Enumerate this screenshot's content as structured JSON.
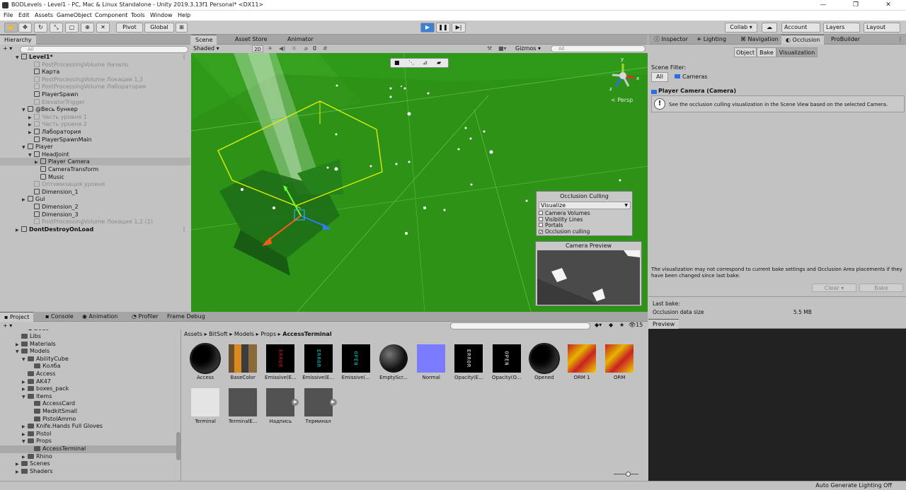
{
  "window": {
    "title": "BODLevels - Level1 - PC, Mac & Linux Standalone - Unity 2019.3.13f1 Personal* <DX11>",
    "minimize": "—",
    "maximize": "❐",
    "close": "✕"
  },
  "menu": [
    "File",
    "Edit",
    "Assets",
    "GameObject",
    "Component",
    "Tools",
    "Window",
    "Help"
  ],
  "toolbar": {
    "pivot": "Pivot",
    "global": "Global",
    "collab": "Collab ▾",
    "account": "Account",
    "layers": "Layers",
    "layout": "Layout",
    "play_icon": "play-icon",
    "pause_icon": "pause-icon",
    "step_icon": "step-icon"
  },
  "hierarchy": {
    "tab": "Hierarchy",
    "add": "+ ▾",
    "search_placeholder": "All",
    "rows": [
      {
        "label": "Level1*",
        "indent": 0,
        "arrow": "▼",
        "dim": false,
        "sel": false,
        "scene": true
      },
      {
        "label": "PostProcessingVolume Начало",
        "indent": 2,
        "arrow": "",
        "dim": true,
        "sel": false
      },
      {
        "label": "Карта",
        "indent": 2,
        "arrow": "",
        "dim": false,
        "sel": false
      },
      {
        "label": "PostProcessingVolume Локация 1,2",
        "indent": 2,
        "arrow": "",
        "dim": true,
        "sel": false
      },
      {
        "label": "PostProcessingVolume Лаборатория",
        "indent": 2,
        "arrow": "",
        "dim": true,
        "sel": false
      },
      {
        "label": "PlayerSpawn",
        "indent": 2,
        "arrow": "",
        "dim": false,
        "sel": false
      },
      {
        "label": "ElevatorTrigger",
        "indent": 2,
        "arrow": "",
        "dim": true,
        "sel": false
      },
      {
        "label": "@Весь бункер",
        "indent": 1,
        "arrow": "▼",
        "dim": false,
        "sel": false
      },
      {
        "label": "Часть уровня 1",
        "indent": 2,
        "arrow": "▶",
        "dim": true,
        "sel": false
      },
      {
        "label": "Часть уровня 2",
        "indent": 2,
        "arrow": "▶",
        "dim": true,
        "sel": false
      },
      {
        "label": "Лаборатория",
        "indent": 2,
        "arrow": "▶",
        "dim": false,
        "sel": false
      },
      {
        "label": "PlayerSpawnMain",
        "indent": 2,
        "arrow": "",
        "dim": false,
        "sel": false
      },
      {
        "label": "Player",
        "indent": 1,
        "arrow": "▼",
        "dim": false,
        "sel": false
      },
      {
        "label": "HeadJoint",
        "indent": 2,
        "arrow": "▼",
        "dim": false,
        "sel": false
      },
      {
        "label": "Player Camera",
        "indent": 3,
        "arrow": "▶",
        "dim": false,
        "sel": true
      },
      {
        "label": "CameraTransform",
        "indent": 3,
        "arrow": "",
        "dim": false,
        "sel": false
      },
      {
        "label": "Music",
        "indent": 3,
        "arrow": "",
        "dim": false,
        "sel": false
      },
      {
        "label": "Оптимизация уровня",
        "indent": 2,
        "arrow": "",
        "dim": true,
        "sel": false
      },
      {
        "label": "Dimension_1",
        "indent": 2,
        "arrow": "",
        "dim": false,
        "sel": false
      },
      {
        "label": "Gui",
        "indent": 1,
        "arrow": "▶",
        "dim": false,
        "sel": false
      },
      {
        "label": "Dimension_2",
        "indent": 2,
        "arrow": "",
        "dim": false,
        "sel": false
      },
      {
        "label": "Dimension_3",
        "indent": 2,
        "arrow": "",
        "dim": false,
        "sel": false
      },
      {
        "label": "PostProcessingVolume Локация 1,2 (1)",
        "indent": 2,
        "arrow": "",
        "dim": true,
        "sel": false
      },
      {
        "label": "DontDestroyOnLoad",
        "indent": 0,
        "arrow": "▶",
        "dim": false,
        "sel": false,
        "scene": true
      }
    ]
  },
  "scene_view": {
    "tabs": [
      "Scene",
      "Asset Store",
      "Animator"
    ],
    "shading": "Shaded ▾",
    "mode_2d": "2D",
    "gizmos": "Gizmos ▾",
    "search_placeholder": "All",
    "persp": "< Persp",
    "hidden_count": "0",
    "gizmo_axes": {
      "x": "x",
      "y": "y",
      "z": "z"
    },
    "occlusion_overlay": {
      "title": "Occlusion Culling",
      "dropdown": "Visualize",
      "options": [
        {
          "label": "Camera Volumes",
          "checked": false
        },
        {
          "label": "Visibility Lines",
          "checked": false
        },
        {
          "label": "Portals",
          "checked": false
        },
        {
          "label": "Occlusion culling",
          "checked": true
        }
      ]
    },
    "camera_preview_title": "Camera Preview"
  },
  "inspector": {
    "tabs": [
      "Inspector",
      "Lighting",
      "Navigation",
      "Occlusion",
      "ProBuilder"
    ],
    "subtabs": [
      "Object",
      "Bake",
      "Visualization"
    ],
    "scene_filter_label": "Scene Filter:",
    "filter_all": "All",
    "filter_cameras": "Cameras",
    "camera_header": "Player Camera (Camera)",
    "info_text": "See the occlusion culling visualization in the Scene View based on the selected Camera.",
    "warning_text": "The visualization may not correspond to current bake settings and Occlusion Area placements if they have been changed since last bake.",
    "clear": "Clear",
    "bake": "Bake",
    "last_bake_label": "Last bake:",
    "occlusion_size_label": "Occlusion data size",
    "occlusion_size_value": "5.5 MB",
    "preview_tab": "Preview"
  },
  "project": {
    "tabs": [
      "Project",
      "Console",
      "Animation",
      "Profiler",
      "Frame Debug"
    ],
    "add": "+ ▾",
    "hidden_count": "15",
    "breadcrumb": [
      "Assets",
      "BitSoft",
      "Models",
      "Props",
      "AccessTerminal"
    ],
    "tree": [
      {
        "label": "Libs",
        "indent": 2,
        "arrow": ""
      },
      {
        "label": "Materials",
        "indent": 2,
        "arrow": "▶"
      },
      {
        "label": "Models",
        "indent": 2,
        "arrow": "▼"
      },
      {
        "label": "AbilityCube",
        "indent": 3,
        "arrow": "▼"
      },
      {
        "label": "Колба",
        "indent": 4,
        "arrow": ""
      },
      {
        "label": "Access",
        "indent": 3,
        "arrow": ""
      },
      {
        "label": "AK47",
        "indent": 3,
        "arrow": "▶"
      },
      {
        "label": "boxes_pack",
        "indent": 3,
        "arrow": "▶"
      },
      {
        "label": "Items",
        "indent": 3,
        "arrow": "▼"
      },
      {
        "label": "AccessCard",
        "indent": 4,
        "arrow": ""
      },
      {
        "label": "MedkitSmall",
        "indent": 4,
        "arrow": ""
      },
      {
        "label": "PistolAmmo",
        "indent": 4,
        "arrow": ""
      },
      {
        "label": "Knife.Hands Full Gloves",
        "indent": 3,
        "arrow": "▶"
      },
      {
        "label": "Pistol",
        "indent": 3,
        "arrow": "▶"
      },
      {
        "label": "Props",
        "indent": 3,
        "arrow": "▼"
      },
      {
        "label": "AccessTerminal",
        "indent": 4,
        "arrow": "",
        "sel": true
      },
      {
        "label": "Rhino",
        "indent": 3,
        "arrow": "▶"
      },
      {
        "label": "Scenes",
        "indent": 2,
        "arrow": "▶"
      },
      {
        "label": "Shaders",
        "indent": 2,
        "arrow": "▶"
      }
    ],
    "assets": [
      {
        "label": "Access",
        "kind": "sphere"
      },
      {
        "label": "BaseColor",
        "kind": "basecolor"
      },
      {
        "label": "Emissive(E...",
        "kind": "error_red"
      },
      {
        "label": "Emissive(E...",
        "kind": "error_cyan"
      },
      {
        "label": "Emissive(...",
        "kind": "open_cyan"
      },
      {
        "label": "EmptyScr...",
        "kind": "sphere_plain"
      },
      {
        "label": "Normal",
        "kind": "normal"
      },
      {
        "label": "Opacity(E...",
        "kind": "error_white"
      },
      {
        "label": "Opacity(O...",
        "kind": "open_white"
      },
      {
        "label": "Opened",
        "kind": "sphere"
      },
      {
        "label": "ORM 1",
        "kind": "orm"
      },
      {
        "label": "ORM",
        "kind": "orm"
      },
      {
        "label": "Terminal",
        "kind": "white"
      },
      {
        "label": "TerminalE...",
        "kind": "mesh"
      },
      {
        "label": "Надпись",
        "kind": "mesh_play"
      },
      {
        "label": "Терминал",
        "kind": "mesh_play"
      }
    ],
    "thumb_text": {
      "error": "ERROR",
      "open": "OPEN"
    }
  },
  "status": {
    "right": "Auto Generate Lighting Off"
  },
  "colors": {
    "scene_green": "#2f9a1a",
    "accent_blue": "#3b7fd6",
    "selection": "#b0b0b0"
  }
}
